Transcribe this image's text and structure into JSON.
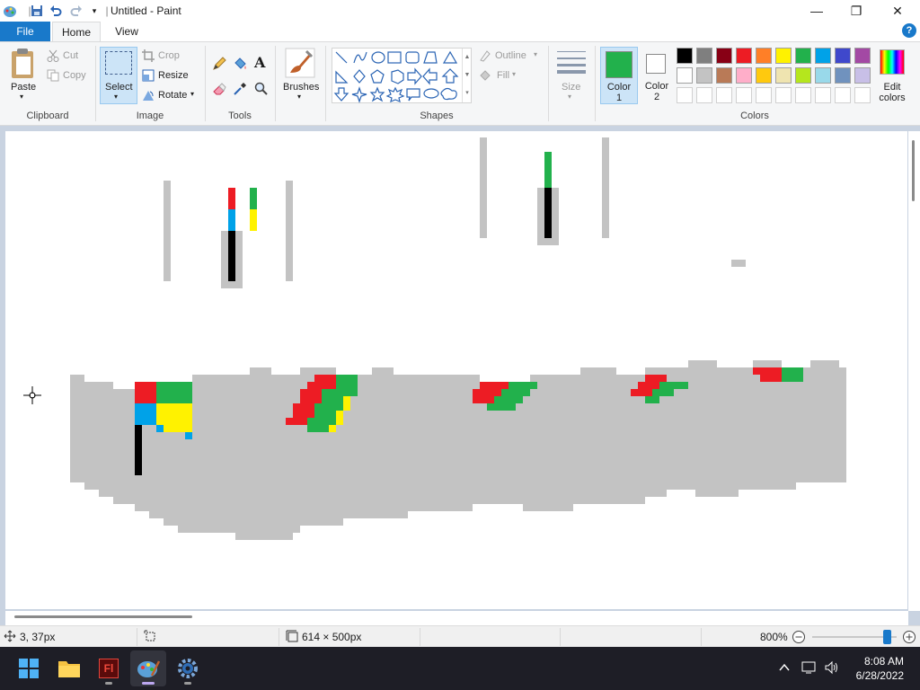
{
  "window": {
    "title": "Untitled - Paint",
    "minimize_glyph": "—",
    "maximize_glyph": "❐",
    "close_glyph": "✕"
  },
  "tabs": {
    "file": "File",
    "home": "Home",
    "view": "View",
    "help": "?"
  },
  "ribbon": {
    "clipboard": {
      "label": "Clipboard",
      "paste": "Paste",
      "cut": "Cut",
      "copy": "Copy"
    },
    "image": {
      "label": "Image",
      "select": "Select",
      "crop": "Crop",
      "resize": "Resize",
      "rotate": "Rotate"
    },
    "tools": {
      "label": "Tools"
    },
    "brushes": {
      "label": "Brushes"
    },
    "shapes": {
      "label": "Shapes",
      "outline": "Outline",
      "fill": "Fill"
    },
    "size": {
      "label": "Size"
    },
    "colors": {
      "label": "Colors",
      "color1_label": "Color 1",
      "color2_label": "Color 2",
      "color1_value": "#22b14c",
      "color2_value": "#ffffff",
      "edit_colors": "Edit colors",
      "palette_row1": [
        "#000000",
        "#7f7f7f",
        "#880015",
        "#ed1c24",
        "#ff7f27",
        "#fff200",
        "#22b14c",
        "#00a2e8",
        "#3f48cc",
        "#a349a4"
      ],
      "palette_row2": [
        "#ffffff",
        "#c3c3c3",
        "#b97a57",
        "#ffaec9",
        "#ffc90e",
        "#efe4b0",
        "#b5e61d",
        "#99d9ea",
        "#7092be",
        "#c8bfe7"
      ]
    }
  },
  "status": {
    "cursor_pos": "3, 37px",
    "canvas_size": "614 × 500px",
    "zoom": "800%"
  },
  "taskbar": {
    "time": "8:08 AM",
    "date": "6/28/2022",
    "apps": [
      "start-icon",
      "file-explorer-icon",
      "flash-app-icon",
      "paint-app-icon",
      "settings-icon"
    ]
  }
}
